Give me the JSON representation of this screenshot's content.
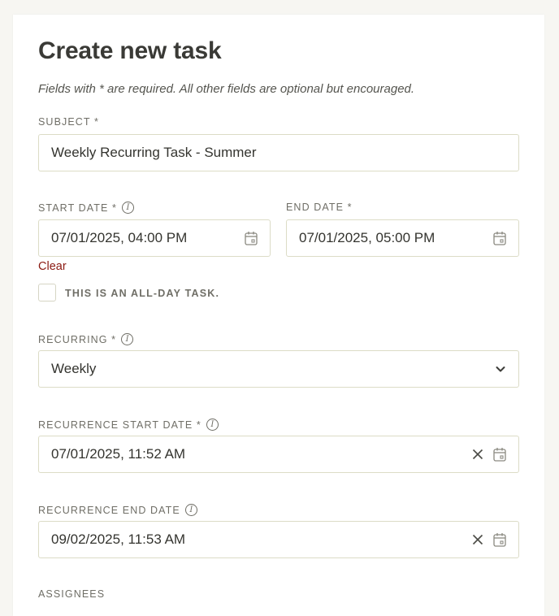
{
  "form": {
    "title": "Create new task",
    "hint": "Fields with * are required. All other fields are optional but encouraged.",
    "subject": {
      "label": "SUBJECT *",
      "value": "Weekly Recurring Task - Summer"
    },
    "start_date": {
      "label": "START DATE *",
      "value": "07/01/2025, 04:00 PM",
      "clear_label": "Clear"
    },
    "end_date": {
      "label": "END DATE *",
      "value": "07/01/2025, 05:00 PM"
    },
    "all_day": {
      "label": "THIS IS AN ALL-DAY TASK.",
      "checked": false
    },
    "recurring": {
      "label": "RECURRING *",
      "value": "Weekly"
    },
    "recurrence_start": {
      "label": "RECURRENCE START DATE *",
      "value": "07/01/2025, 11:52 AM"
    },
    "recurrence_end": {
      "label": "RECURRENCE END DATE",
      "value": "09/02/2025, 11:53 AM"
    },
    "assignees": {
      "label": "ASSIGNEES"
    }
  },
  "icons": {
    "info": "info-icon",
    "calendar": "calendar-icon",
    "clear": "close-icon",
    "dropdown": "chevron-down-icon"
  },
  "colors": {
    "page_bg": "#f7f6f2",
    "card_bg": "#ffffff",
    "border": "#dcdcc6",
    "label": "#6f6e66",
    "clear_link": "#8b1a12"
  }
}
